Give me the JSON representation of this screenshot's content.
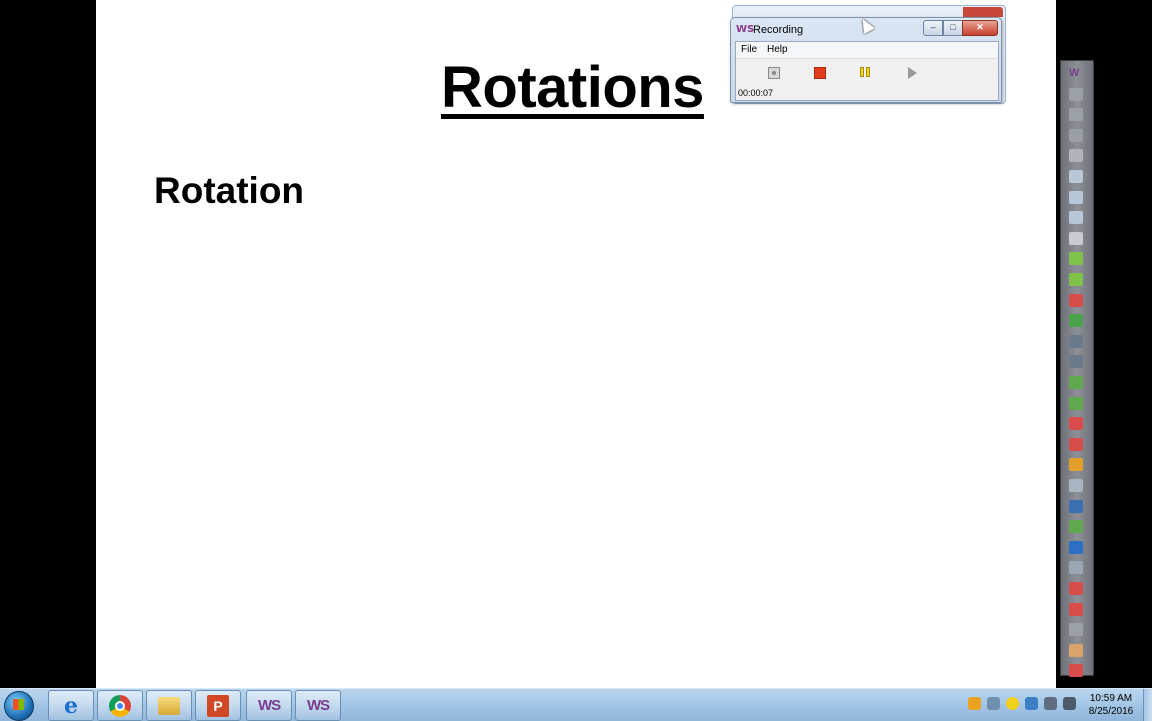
{
  "slide": {
    "title": "Rotations",
    "subtitle": "Rotation"
  },
  "recording_window": {
    "app_logo": "WS",
    "title": "Recording",
    "minimize_icon": "minimize-icon",
    "maximize_icon": "maximize-icon",
    "close_icon": "close-icon",
    "menu": [
      "File",
      "Help"
    ],
    "tools": [
      "record-icon",
      "stop-icon",
      "pause-icon",
      "play-icon"
    ],
    "elapsed_time": "00:00:07"
  },
  "side_toolbar": {
    "icons": [
      "ws-logo-icon",
      "dots-icon",
      "dots-icon",
      "dots-icon",
      "rotate-icon",
      "copy-icon",
      "save-icon",
      "screen-icon",
      "pointer-icon",
      "arrow-left-icon",
      "arrow-right-icon",
      "pen-icon",
      "highlighter-icon",
      "eraser-icon",
      "eraser-icon",
      "insert-text-icon",
      "insert-shape-icon",
      "red-pen-icon",
      "spray-icon",
      "warning-icon",
      "keyboard-icon",
      "edit-icon",
      "camera-icon",
      "display-icon",
      "layers-icon",
      "document-icon",
      "document-color-icon",
      "close-x-icon",
      "clear-icon",
      "exit-icon"
    ]
  },
  "taskbar": {
    "apps": [
      {
        "name": "internet-explorer",
        "glyph": "e"
      },
      {
        "name": "chrome",
        "glyph": ""
      },
      {
        "name": "file-explorer",
        "glyph": ""
      },
      {
        "name": "powerpoint",
        "glyph": "P"
      },
      {
        "name": "writing-studio-1",
        "glyph": "WS"
      },
      {
        "name": "writing-studio-2",
        "glyph": "WS"
      }
    ],
    "tray_icons": [
      "shield-icon",
      "network-icon",
      "info-icon",
      "network-status-icon",
      "monitor-icon",
      "volume-icon"
    ],
    "clock_time": "10:59 AM",
    "clock_date": "8/25/2016"
  },
  "colors": {
    "slide_background": "#ffffff",
    "taskbar": "#a8c8ea",
    "stop_red": "#e23b1c",
    "pause_yellow": "#f2d21a"
  }
}
